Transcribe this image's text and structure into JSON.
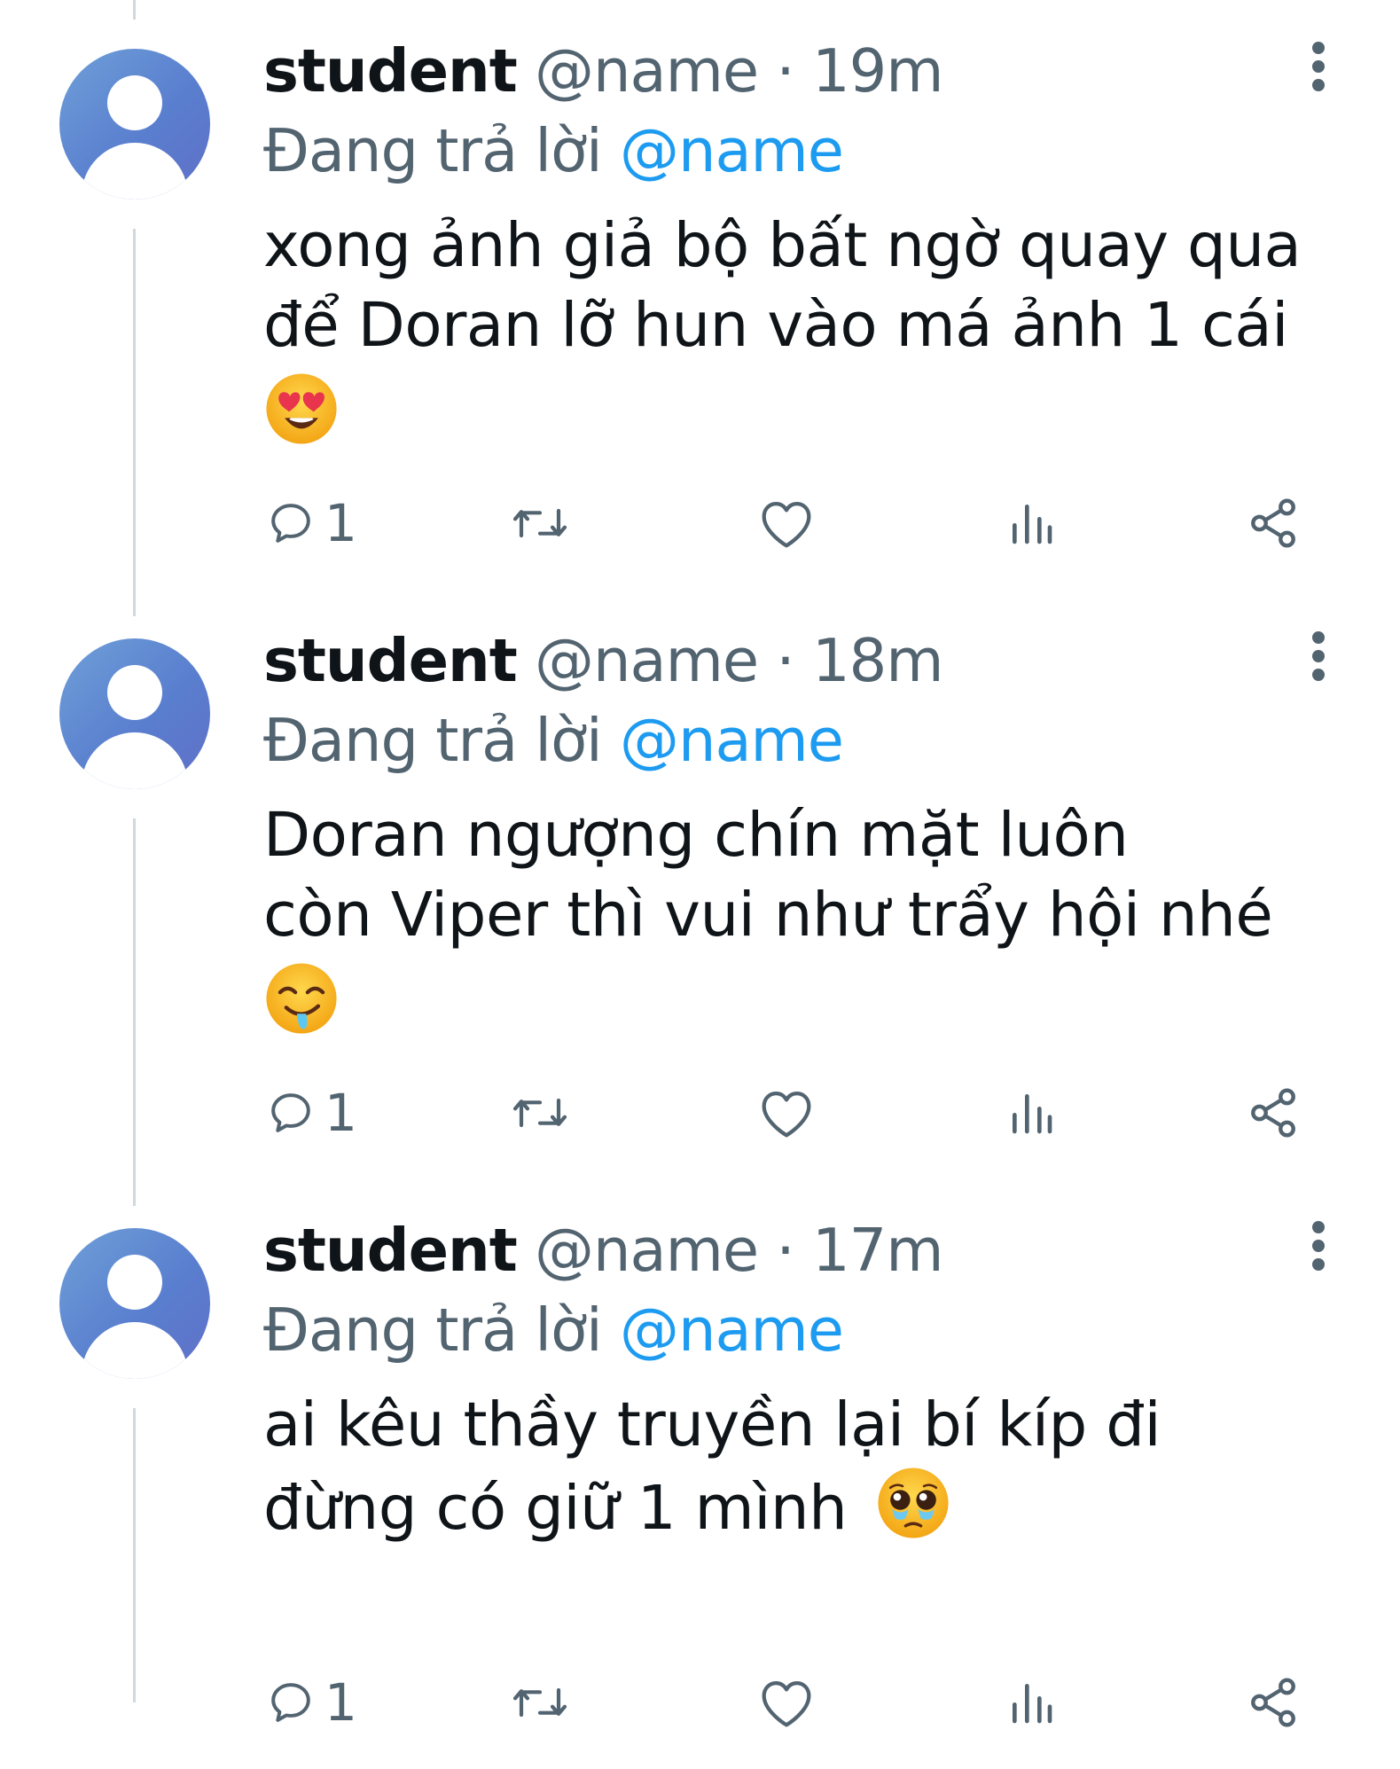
{
  "colors": {
    "text": "#0f1419",
    "muted": "#536471",
    "mention": "#1d9bf0",
    "thread_line": "#cfd9de"
  },
  "tweets": [
    {
      "display_name": "student",
      "handle": "@name",
      "separator": "·",
      "time": "19m",
      "reply_prefix": "Đang trả lời",
      "reply_to": "@name",
      "text_lines": [
        "xong ảnh giả bộ bất ngờ quay qua",
        "để Doran lỡ hun vào má ảnh 1 cái"
      ],
      "emoji": "heart-eyes-emoji",
      "reply_count": "1"
    },
    {
      "display_name": "student",
      "handle": "@name",
      "separator": "·",
      "time": "18m",
      "reply_prefix": "Đang trả lời",
      "reply_to": "@name",
      "text_lines": [
        "Doran ngượng chín mặt luôn",
        "còn Viper thì vui như trẩy hội nhé"
      ],
      "emoji": "drooling-face-emoji",
      "reply_count": "1"
    },
    {
      "display_name": "student",
      "handle": "@name",
      "separator": "·",
      "time": "17m",
      "reply_prefix": "Đang trả lời",
      "reply_to": "@name",
      "text_lines": [
        "ai kêu thầy truyền lại bí kíp đi",
        "đừng có giữ 1 mình"
      ],
      "emoji": "pleading-face-emoji",
      "reply_count": "1"
    }
  ]
}
